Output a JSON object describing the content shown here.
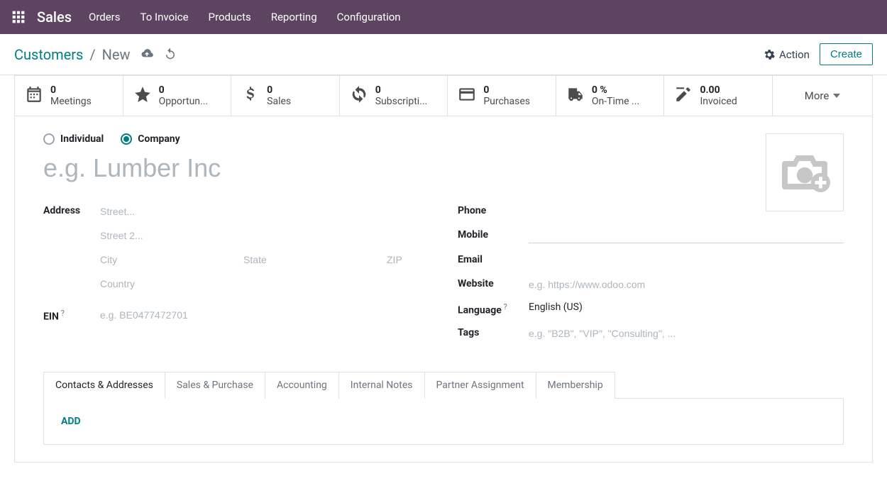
{
  "topbar": {
    "app_name": "Sales",
    "nav": [
      "Orders",
      "To Invoice",
      "Products",
      "Reporting",
      "Configuration"
    ]
  },
  "breadcrumb": {
    "root": "Customers",
    "current": "New",
    "action_label": "Action",
    "create_label": "Create"
  },
  "stats": [
    {
      "value": "0",
      "label": "Meetings"
    },
    {
      "value": "0",
      "label": "Opportun..."
    },
    {
      "value": "0",
      "label": "Sales"
    },
    {
      "value": "0",
      "label": "Subscripti..."
    },
    {
      "value": "0",
      "label": "Purchases"
    },
    {
      "value": "0 %",
      "label": "On-Time ..."
    },
    {
      "value": "0.00",
      "label": "Invoiced"
    }
  ],
  "more_label": "More",
  "type": {
    "individual": "Individual",
    "company": "Company",
    "selected": "company"
  },
  "name_placeholder": "e.g. Lumber Inc",
  "left_fields": {
    "address_label": "Address",
    "street_ph": "Street...",
    "street2_ph": "Street 2...",
    "city_ph": "City",
    "state_ph": "State",
    "zip_ph": "ZIP",
    "country_ph": "Country",
    "ein_label": "EIN",
    "ein_ph": "e.g. BE0477472701"
  },
  "right_fields": {
    "phone_label": "Phone",
    "mobile_label": "Mobile",
    "email_label": "Email",
    "website_label": "Website",
    "website_ph": "e.g. https://www.odoo.com",
    "language_label": "Language",
    "language_value": "English (US)",
    "tags_label": "Tags",
    "tags_ph": "e.g. \"B2B\", \"VIP\", \"Consulting\", ..."
  },
  "tabs": [
    "Contacts & Addresses",
    "Sales & Purchase",
    "Accounting",
    "Internal Notes",
    "Partner Assignment",
    "Membership"
  ],
  "add_label": "ADD"
}
